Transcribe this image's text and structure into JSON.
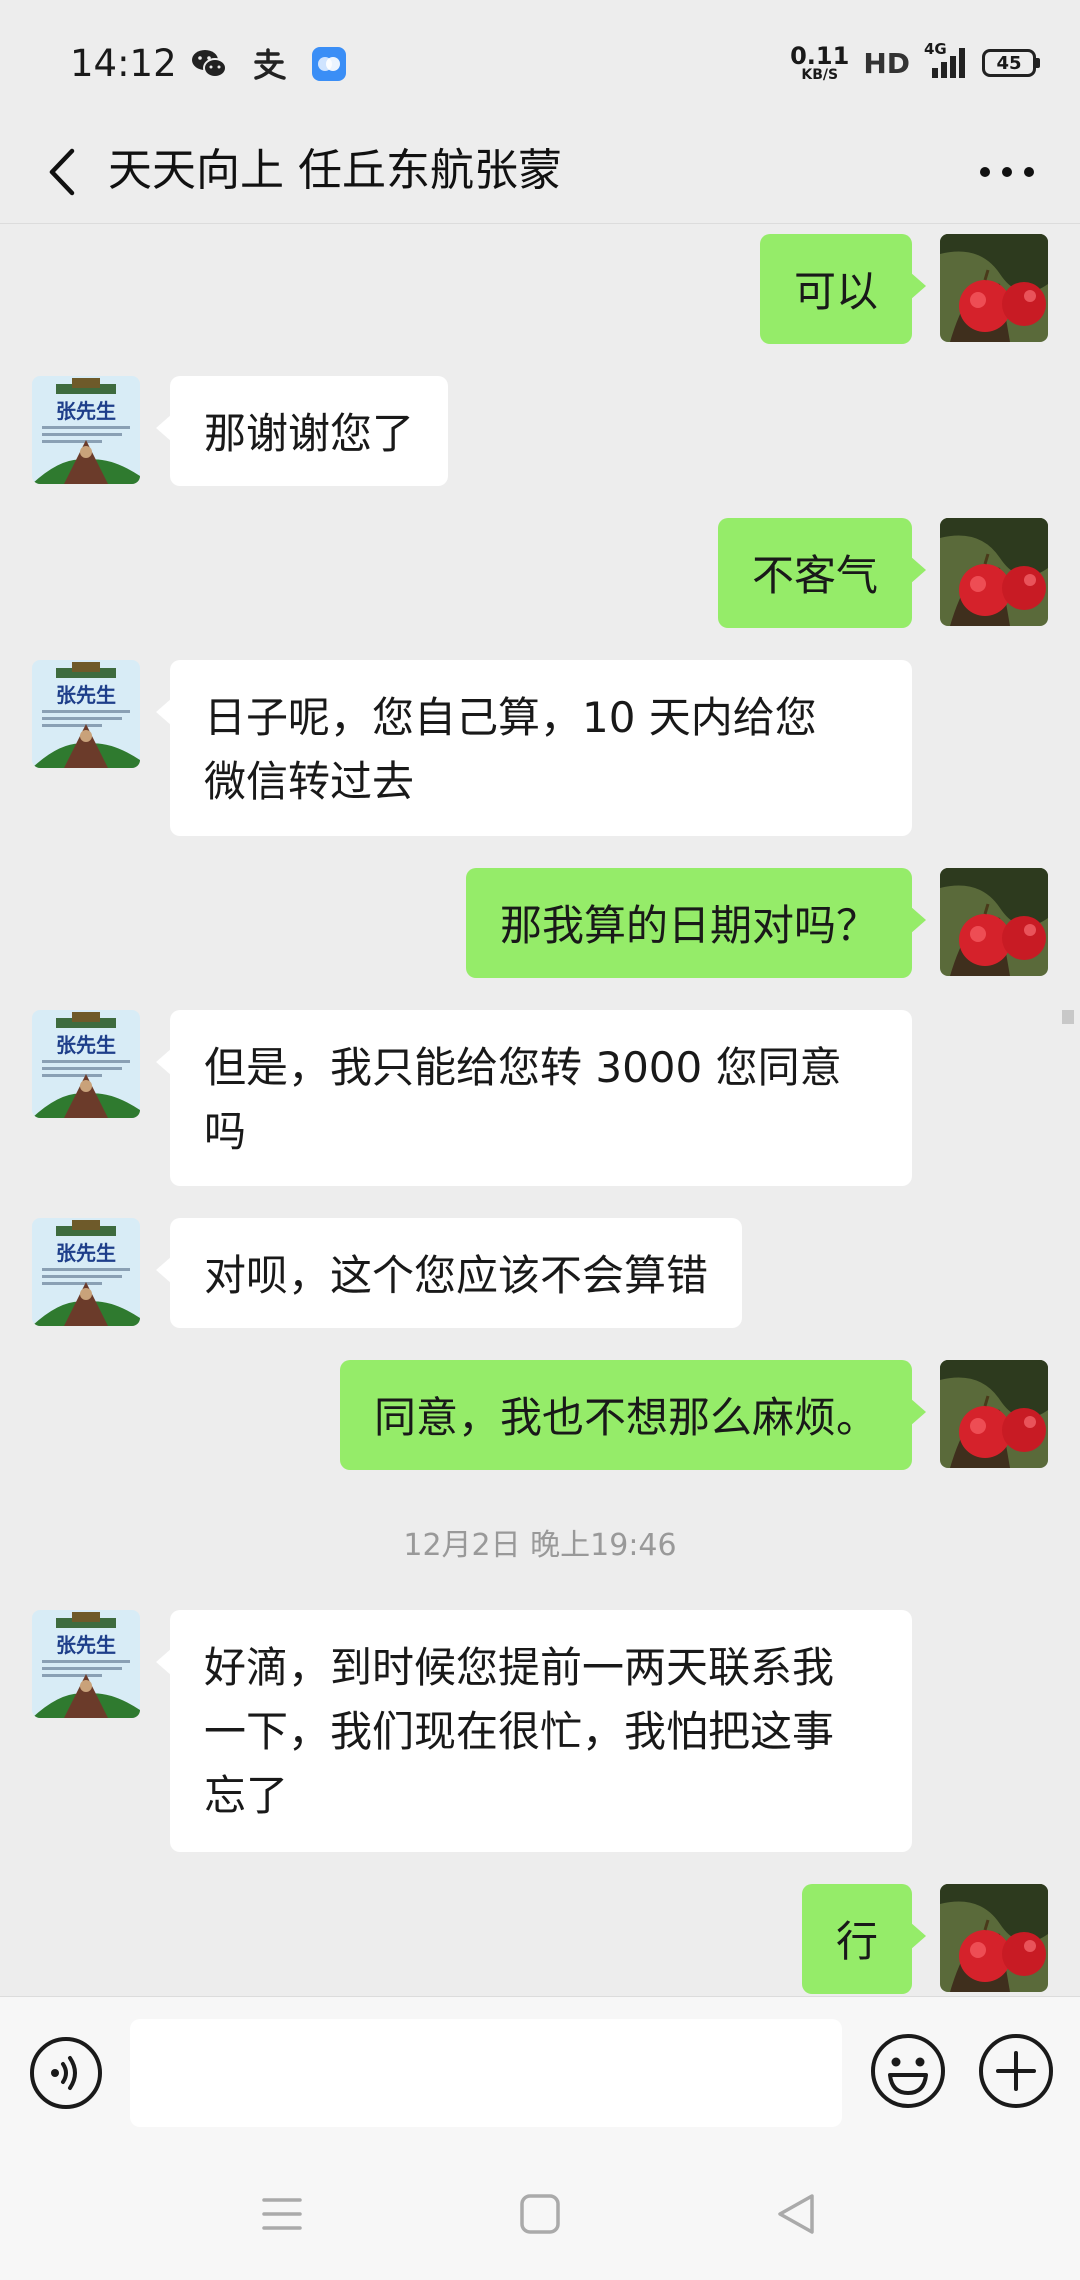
{
  "status_bar": {
    "time": "14:12",
    "net_speed_value": "0.11",
    "net_speed_unit": "KB/S",
    "hd_label": "HD",
    "network_label": "4G",
    "battery_level": "45",
    "icons": [
      "wechat-icon",
      "alipay-icon",
      "app-icon"
    ]
  },
  "header": {
    "title": "天天向上 任丘东航张蒙"
  },
  "avatar_other_label": "张先生",
  "messages": [
    {
      "sender": "self",
      "text": "可以"
    },
    {
      "sender": "other",
      "text": "那谢谢您了"
    },
    {
      "sender": "self",
      "text": "不客气"
    },
    {
      "sender": "other",
      "line1": "日子呢，您自己算，10 天内给您",
      "line2": "微信转过去"
    },
    {
      "sender": "self",
      "text": "那我算的日期对吗？"
    },
    {
      "sender": "other",
      "line1": "但是，我只能给您转 3000 您同意",
      "line2": "吗"
    },
    {
      "sender": "other",
      "text": "对呗，这个您应该不会算错"
    },
    {
      "sender": "self",
      "text": "同意，我也不想那么麻烦。"
    },
    {
      "type": "timestamp",
      "text": "12月2日 晚上19:46"
    },
    {
      "sender": "other",
      "line1": "好滴，到时候您提前一两天联系我",
      "line2": "一下，我们现在很忙，我怕把这事",
      "line3": "忘了"
    },
    {
      "sender": "self",
      "text": "行"
    }
  ],
  "colors": {
    "self_bubble": "#95ec69",
    "other_bubble": "#ffffff",
    "background": "#ededed"
  }
}
